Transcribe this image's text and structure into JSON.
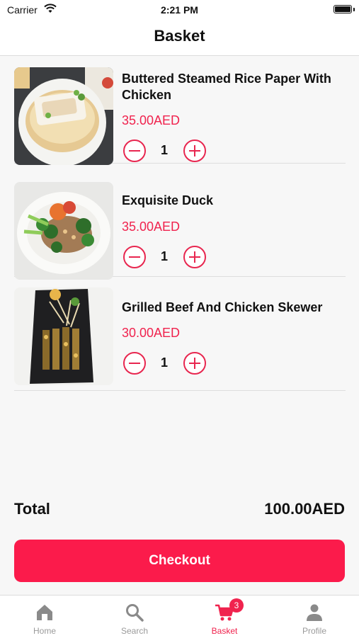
{
  "status_bar": {
    "carrier": "Carrier",
    "time": "2:21 PM"
  },
  "header": {
    "title": "Basket"
  },
  "basket": {
    "items": [
      {
        "name": "Buttered Steamed Rice Paper With Chicken",
        "price": "35.00AED",
        "quantity": "1"
      },
      {
        "name": "Exquisite Duck",
        "price": "35.00AED",
        "quantity": "1"
      },
      {
        "name": "Grilled Beef And Chicken Skewer",
        "price": "30.00AED",
        "quantity": "1"
      }
    ]
  },
  "summary": {
    "total_label": "Total",
    "total_value": "100.00AED"
  },
  "checkout_label": "Checkout",
  "tabs": [
    {
      "label": "Home",
      "icon": "home-icon"
    },
    {
      "label": "Search",
      "icon": "search-icon"
    },
    {
      "label": "Basket",
      "icon": "cart-icon",
      "badge": "3",
      "active": true
    },
    {
      "label": "Profile",
      "icon": "person-icon"
    }
  ],
  "colors": {
    "accent": "#f0234e",
    "checkout": "#fb1b4b",
    "inactive_tab": "#9a9a9a"
  }
}
